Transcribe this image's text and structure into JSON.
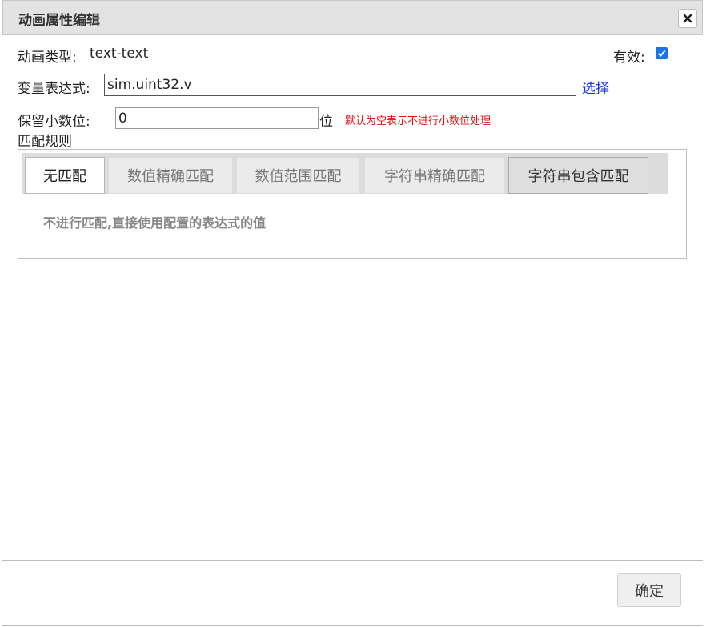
{
  "dialog": {
    "title": "动画属性编辑",
    "close_icon": "close-icon"
  },
  "form": {
    "animation_type_label": "动画类型:",
    "animation_type_value": "text-text",
    "valid_label": "有效:",
    "valid_checked": true,
    "expression_label": "变量表达式:",
    "expression_value": "sim.uint32.v",
    "choose_link": "选择",
    "decimal_label": "保留小数位:",
    "decimal_value": "0",
    "decimal_unit": "位",
    "decimal_hint": "默认为空表示不进行小数位处理",
    "match_rules_label": "匹配规则"
  },
  "match": {
    "tabs": [
      {
        "label": "无匹配",
        "state": "active"
      },
      {
        "label": "数值精确匹配",
        "state": "normal"
      },
      {
        "label": "数值范围匹配",
        "state": "normal"
      },
      {
        "label": "字符串精确匹配",
        "state": "normal"
      },
      {
        "label": "字符串包含匹配",
        "state": "hover"
      }
    ],
    "description": "不进行匹配,直接使用配置的表达式的值"
  },
  "footer": {
    "ok_label": "确定"
  },
  "colors": {
    "accent": "#1a73e8",
    "link": "#1a35d8",
    "hint": "#e01010"
  }
}
